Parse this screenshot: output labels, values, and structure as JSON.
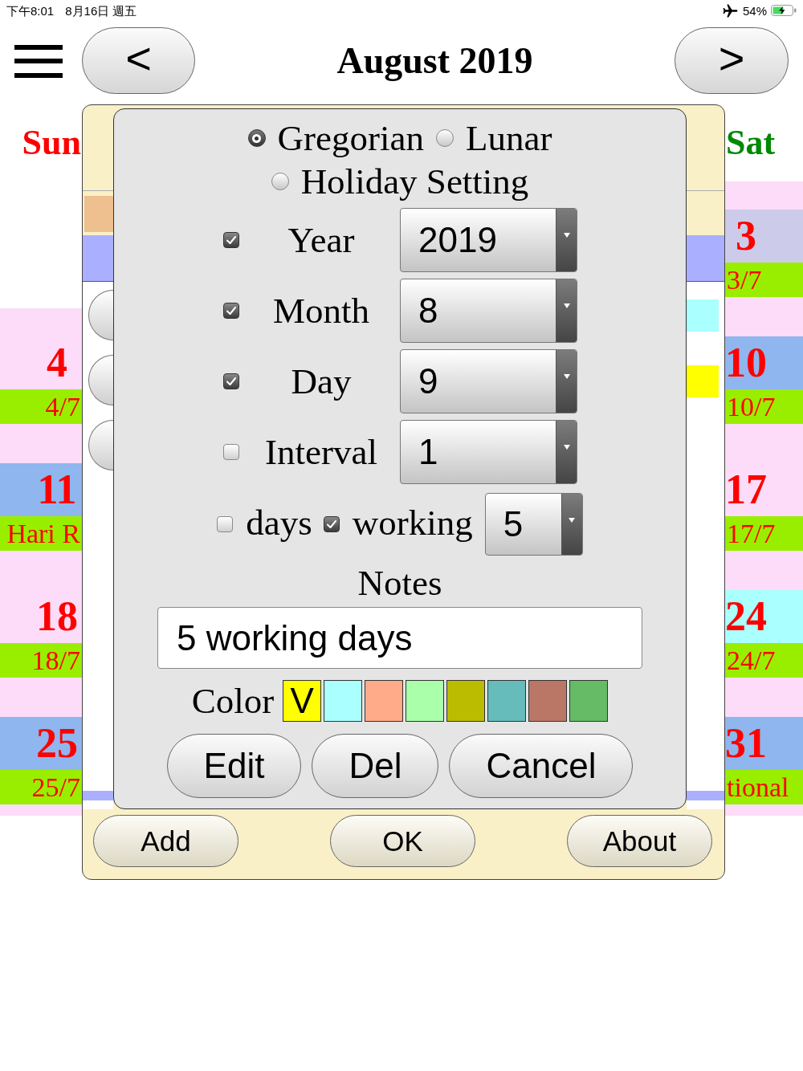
{
  "status_bar": {
    "time": "下午8:01",
    "date": "8月16日 週五",
    "battery": "54%"
  },
  "header": {
    "prev_button": "<",
    "title": "August 2019",
    "next_button": ">"
  },
  "calendar": {
    "columns": [
      {
        "header": "Sun",
        "color": "#ff0000",
        "cells": [
          {
            "day": "4",
            "color": "#fcdcf8",
            "note": "4/7"
          },
          {
            "day": "11",
            "color": "#8fb6ee",
            "note": "Hari R"
          },
          {
            "day": "18",
            "color": "#fcdcf8",
            "note": "18/7"
          },
          {
            "day": "25",
            "color": "#8fb6ee",
            "note": "25/7"
          }
        ]
      },
      {
        "header": "Sat",
        "color": "#008800",
        "cells": [
          {
            "day": "3",
            "color": "#ccccea",
            "note": "3/7"
          },
          {
            "day": "10",
            "color": "#8fb6ee",
            "note": "10/7"
          },
          {
            "day": "17",
            "color": "#fcdcf8",
            "note": "17/7"
          },
          {
            "day": "24",
            "color": "#aaffff",
            "note": "24/7"
          },
          {
            "day": "31",
            "color": "#8fb6ee",
            "note": "tional"
          }
        ]
      }
    ]
  },
  "panel": {
    "left_edge": {
      "header_block": {
        "color": "#eebf8f"
      }
    },
    "right_edge": {
      "blocks": [
        {
          "color": "#aaffff"
        },
        {
          "color": "#ffff00"
        }
      ]
    },
    "footer_buttons": [
      "Add",
      "OK",
      "About"
    ]
  },
  "dialog": {
    "calendar_modes": [
      {
        "label": "Gregorian",
        "selected": true
      },
      {
        "label": "Lunar",
        "selected": false
      },
      {
        "label": "Holiday Setting",
        "selected": false
      }
    ],
    "fields": [
      {
        "label": "Year",
        "checked": true,
        "value": "2019"
      },
      {
        "label": "Month",
        "checked": true,
        "value": "8"
      },
      {
        "label": "Day",
        "checked": true,
        "value": "9"
      },
      {
        "label": "Interval",
        "checked": false,
        "value": "1"
      }
    ],
    "interval_units": [
      {
        "label": "days",
        "checked": false
      },
      {
        "label": "working",
        "checked": true
      }
    ],
    "interval_count": {
      "value": "5"
    },
    "notes": {
      "label": "Notes",
      "value": "5 working days"
    },
    "color_picker": {
      "label": "Color",
      "selected_mark": "V",
      "swatches": [
        {
          "color": "#ffff00",
          "selected": true
        },
        {
          "color": "#aaffff",
          "selected": false
        },
        {
          "color": "#ffaa88",
          "selected": false
        },
        {
          "color": "#aaffaa",
          "selected": false
        },
        {
          "color": "#bbbb00",
          "selected": false
        },
        {
          "color": "#66bbbb",
          "selected": false
        },
        {
          "color": "#bb7766",
          "selected": false
        },
        {
          "color": "#66bb66",
          "selected": false
        }
      ]
    },
    "buttons": [
      "Edit",
      "Del",
      "Cancel"
    ]
  }
}
